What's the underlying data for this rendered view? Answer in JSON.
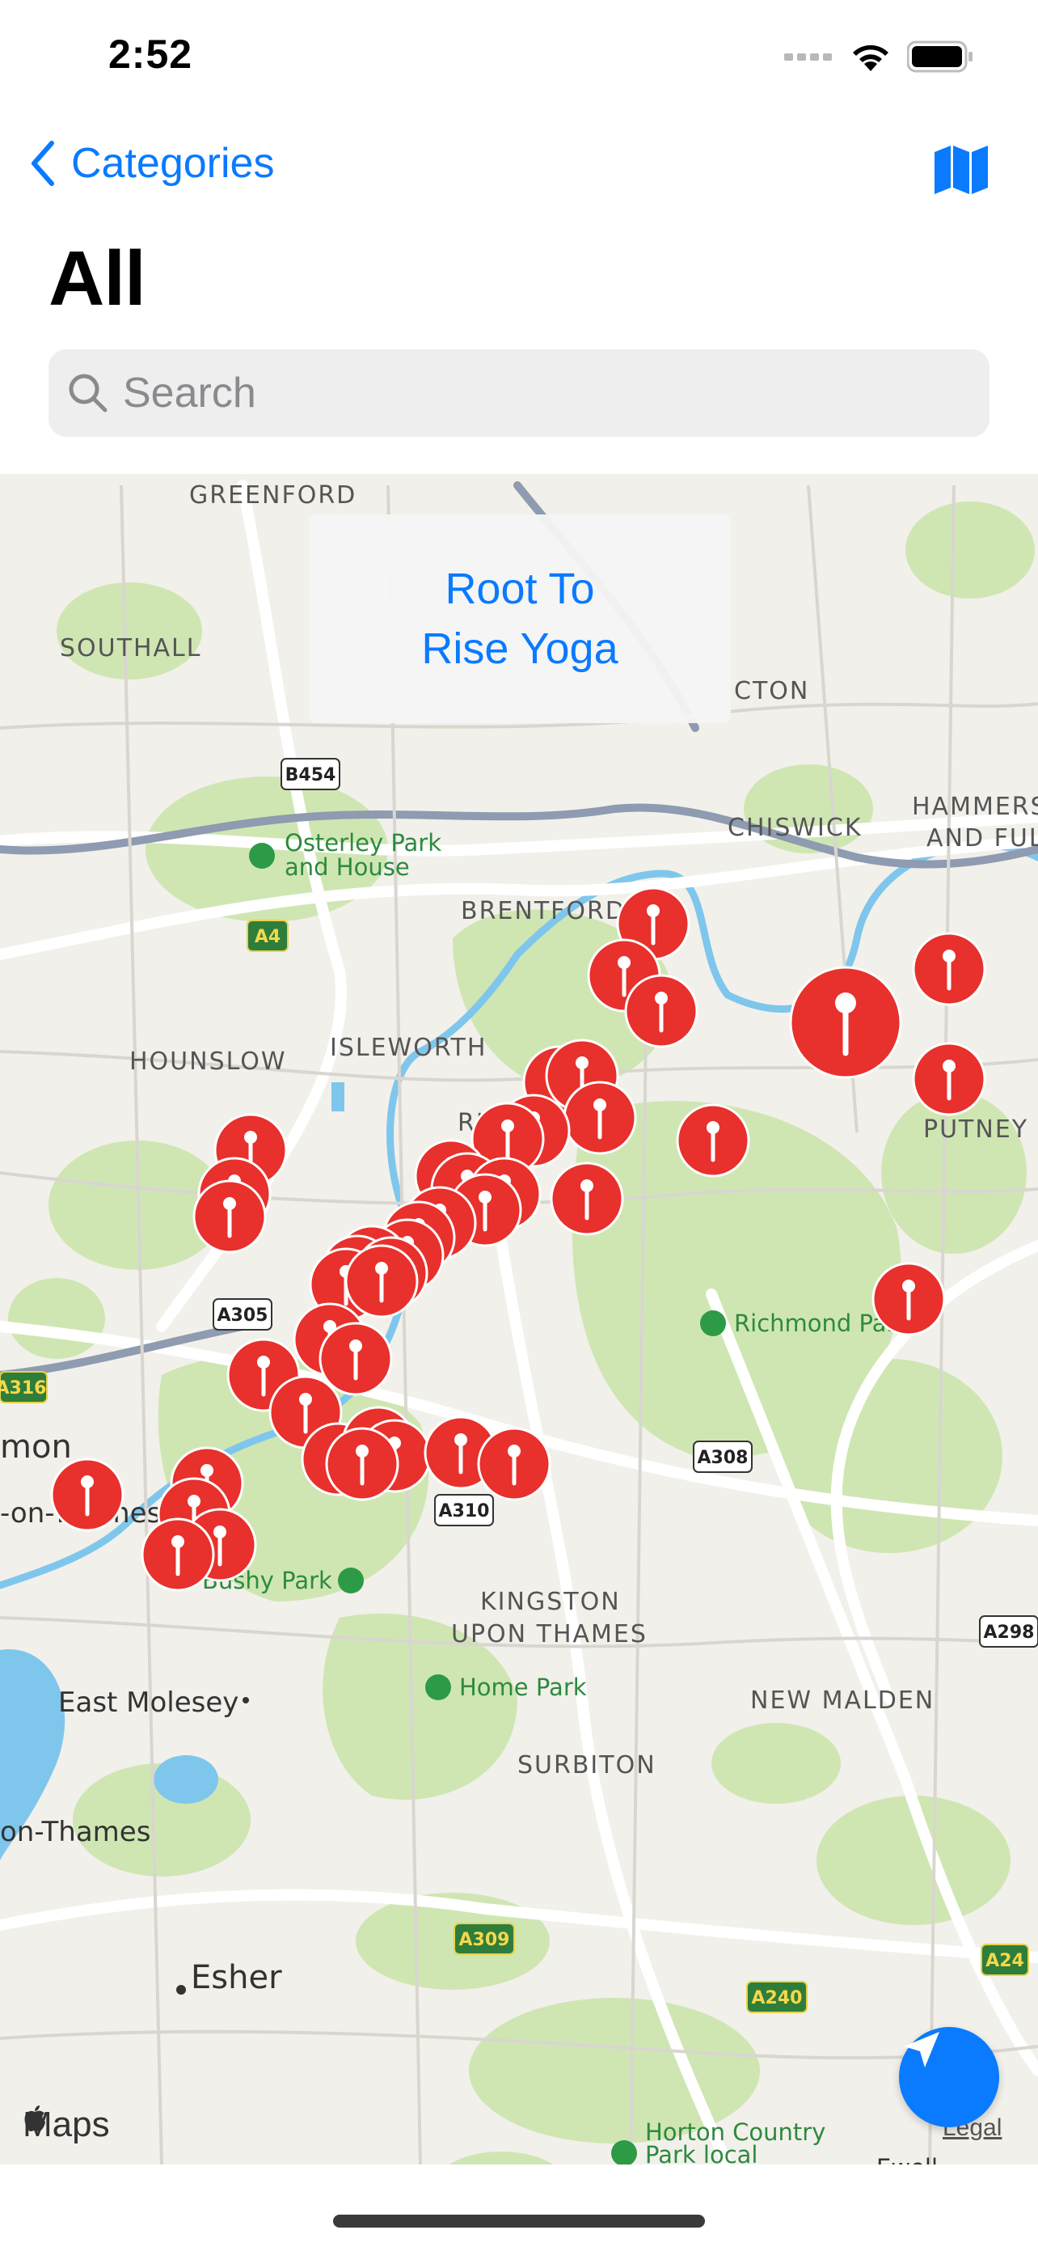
{
  "status_bar": {
    "time": "2:52"
  },
  "nav": {
    "back_label": "Categories",
    "title": "All"
  },
  "search": {
    "placeholder": "Search"
  },
  "callout": {
    "line1": "Root To",
    "line2": "Rise Yoga"
  },
  "map": {
    "labels": [
      {
        "key": "greenford",
        "text": "GREENFORD"
      },
      {
        "key": "southall",
        "text": "SOUTHALL"
      },
      {
        "key": "acton",
        "text": "CTON"
      },
      {
        "key": "chiswick",
        "text": "CHISWICK"
      },
      {
        "key": "hammersmith1",
        "text": "HAMMERS"
      },
      {
        "key": "hammersmith2",
        "text": "AND FUL"
      },
      {
        "key": "brentford",
        "text": "BRENTFORD"
      },
      {
        "key": "hounslow",
        "text": "HOUNSLOW"
      },
      {
        "key": "isleworth",
        "text": "ISLEWORTH"
      },
      {
        "key": "richmond",
        "text": "RICHMOND"
      },
      {
        "key": "putney",
        "text": "PUTNEY"
      },
      {
        "key": "kingston1",
        "text": "KINGSTON"
      },
      {
        "key": "kingston2",
        "text": "UPON THAMES"
      },
      {
        "key": "new_malden",
        "text": "NEW MALDEN"
      },
      {
        "key": "surbiton",
        "text": "SURBITON"
      },
      {
        "key": "east_molesey",
        "text": "East Molesey"
      },
      {
        "key": "esher",
        "text": "Esher"
      },
      {
        "key": "on_thames",
        "text": "on-Thames"
      },
      {
        "key": "mon",
        "text": "mon"
      },
      {
        "key": "on_thames2",
        "text": "-on-Thames"
      },
      {
        "key": "osterley1",
        "text": "Osterley Park"
      },
      {
        "key": "osterley2",
        "text": "and House"
      },
      {
        "key": "richmond_park",
        "text": "Richmond Park"
      },
      {
        "key": "bushy_park",
        "text": "Bushy Park"
      },
      {
        "key": "home_park",
        "text": "Home Park"
      },
      {
        "key": "horton1",
        "text": "Horton Country"
      },
      {
        "key": "horton2",
        "text": "Park local"
      },
      {
        "key": "ewell",
        "text": "Ewell"
      }
    ],
    "roads": [
      {
        "key": "b454",
        "text": "B454"
      },
      {
        "key": "a4",
        "text": "A4"
      },
      {
        "key": "a305",
        "text": "A305"
      },
      {
        "key": "a316",
        "text": "A316"
      },
      {
        "key": "a308",
        "text": "A308"
      },
      {
        "key": "a310",
        "text": "A310"
      },
      {
        "key": "a298",
        "text": "A298"
      },
      {
        "key": "a309",
        "text": "A309"
      },
      {
        "key": "a240",
        "text": "A240"
      },
      {
        "key": "a24",
        "text": "A24"
      }
    ],
    "pin_color": "#e8302c",
    "pin_count": 40,
    "attribution": "Maps",
    "legal": "Legal"
  },
  "colors": {
    "accent": "#0a7aff",
    "park": "#c7e3a6",
    "water": "#7fc6ec",
    "land": "#f2f0ea"
  }
}
